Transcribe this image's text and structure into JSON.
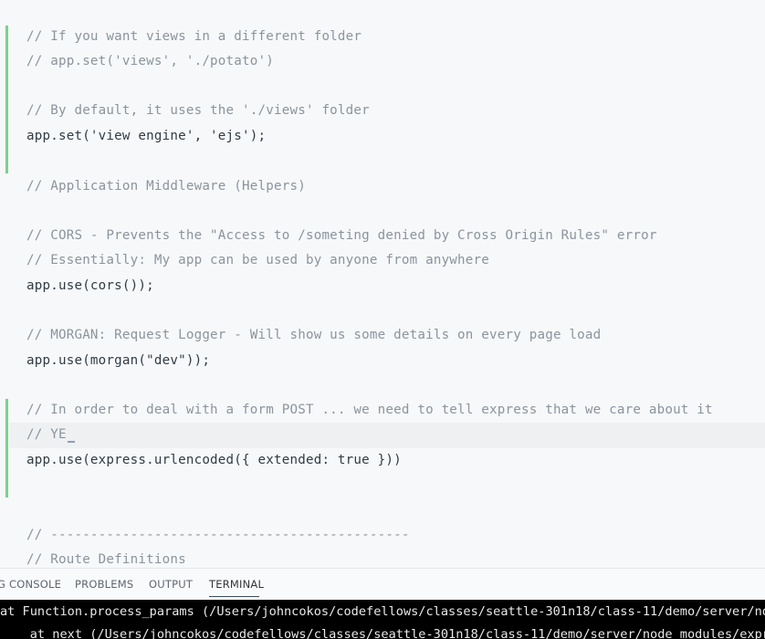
{
  "editor": {
    "lines": [
      "// If you want views in a different folder",
      "// app.set('views', './potato')",
      "// By default, it uses the './views' folder",
      "app.set('view engine', 'ejs');",
      "// Application Middleware (Helpers)",
      "// CORS - Prevents the \"Access to /someting denied by Cross Origin Rules\" error",
      "// Essentially: My app can be used by anyone from anywhere",
      "app.use(cors());",
      "// MORGAN: Request Logger - Will show us some details on every page load",
      "app.use(morgan(\"dev\"));",
      "// In order to deal with a form POST ... we need to tell express that we care about it",
      "// YE",
      "app.use(express.urlencoded({ extended: true }))",
      "// ---------------------------------------------",
      "// Route Definitions"
    ]
  },
  "panel": {
    "tabs": [
      {
        "label": "G CONSOLE"
      },
      {
        "label": "PROBLEMS"
      },
      {
        "label": "OUTPUT"
      },
      {
        "label": "TERMINAL"
      }
    ],
    "terminal_lines": [
      "at Function.process_params (/Users/johncokos/codefellows/classes/seattle-301n18/class-11/demo/server/node_m",
      "    at next (/Users/johncokos/codefellows/classes/seattle-301n18/class-11/demo/server/node_modules/express/li"
    ]
  }
}
